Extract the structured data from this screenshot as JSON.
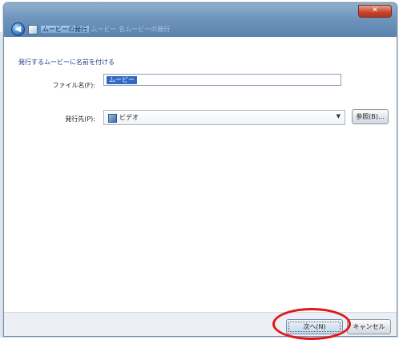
{
  "window": {
    "title": "",
    "close_label": "✕"
  },
  "nav": {
    "back_icon": "back-arrow-icon",
    "app_icon": "movie-maker-icon",
    "breadcrumb_current": "ムービーの発行",
    "breadcrumb_rest": "ムービー 名ムービーの発行"
  },
  "main": {
    "heading": "発行するムービーに名前を付ける",
    "file_name_label": "ファイル名(F):",
    "file_name_value": "ムービー",
    "destination_label": "発行先(P):",
    "destination_value": "ビデオ",
    "browse_label": "参照(B)..."
  },
  "footer": {
    "next_label": "次へ(N)",
    "cancel_label": "キャンセル"
  },
  "colors": {
    "accent": "#3068c4",
    "heading": "#1c3e8c",
    "annotation": "#e0161a"
  }
}
